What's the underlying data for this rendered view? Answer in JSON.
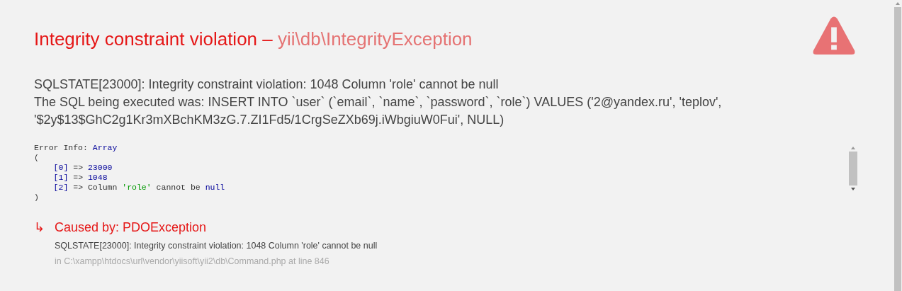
{
  "header": {
    "name": "Integrity constraint violation",
    "separator": "–",
    "class": "yii\\db\\IntegrityException"
  },
  "message": [
    "SQLSTATE[23000]: Integrity constraint violation: 1048 Column 'role' cannot be null",
    "The SQL being executed was: INSERT INTO `user` (`email`, `name`, `password`, `role`) VALUES ('2@yandex.ru', 'teplov', '$2y$13$GhC2g1Kr3mXBchKM3zG.7.ZI1Fd5/1CrgSeZXb69j.iWbgiuW0Fui', NULL)"
  ],
  "error_info": {
    "label": "Error Info:",
    "type": "Array",
    "open": "(",
    "close": ")",
    "entries": [
      {
        "key": "[0]",
        "arrow": "=>",
        "tokens": [
          {
            "text": "23000",
            "kind": "number"
          }
        ]
      },
      {
        "key": "[1]",
        "arrow": "=>",
        "tokens": [
          {
            "text": "1048",
            "kind": "number"
          }
        ]
      },
      {
        "key": "[2]",
        "arrow": "=>",
        "tokens": [
          {
            "text": "Column",
            "kind": "plain"
          },
          {
            "text": "'role'",
            "kind": "string"
          },
          {
            "text": "cannot be",
            "kind": "plain"
          },
          {
            "text": "null",
            "kind": "keyword"
          }
        ]
      }
    ]
  },
  "previous": {
    "arrow": "↳",
    "title": "Caused by: PDOException",
    "message": "SQLSTATE[23000]: Integrity constraint violation: 1048 Column 'role' cannot be null",
    "location": "in C:\\xampp\\htdocs\\url\\vendor\\yiisoft\\yii2\\db\\Command.php at line 846"
  }
}
